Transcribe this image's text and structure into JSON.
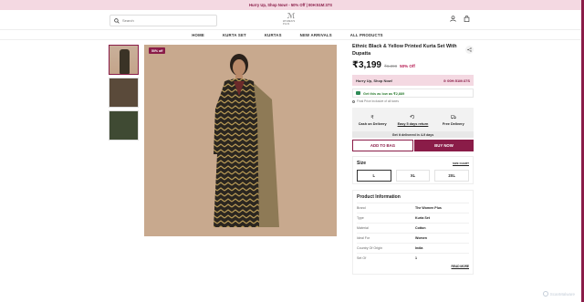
{
  "promo": {
    "text": "Hurry Up, Shop Now! - 50% Off   |   00H:51M:37S"
  },
  "header": {
    "search_placeholder": "Search",
    "logo_text": "WOMEN'S PLUS"
  },
  "nav": {
    "items": [
      "HOME",
      "KURTA SET",
      "KURTAS",
      "NEW ARRIVALS",
      "ALL PRODUCTS"
    ]
  },
  "gallery": {
    "badge": "50% off"
  },
  "product": {
    "title": "Ethnic Black & Yellow Printed Kurta Set With Dupatta",
    "price": "₹3,199",
    "mrp": "₹6,398",
    "discount": "50% Off",
    "hurry_label": "Hurry Up, Shop Now!",
    "timer": "⊙ 00H:51M:37S",
    "as_low_as": "Get this as low as ₹2,889",
    "inclusive": "Final Price Inclusive of all taxes",
    "features": [
      "Cash on Delivery",
      "Easy 5 days return",
      "Free Delivery"
    ],
    "delivery_note": "Get it delivered in 4-9 days",
    "add_to_bag": "ADD TO BAG",
    "buy_now": "BUY NOW"
  },
  "size": {
    "label": "Size",
    "chart_link": "SIZE CHART",
    "options": [
      "L",
      "XL",
      "2XL"
    ],
    "selected": "L"
  },
  "info": {
    "heading": "Product Information",
    "rows": [
      {
        "k": "Brand",
        "v": "The Women Plus"
      },
      {
        "k": "Type",
        "v": "Kurta Set"
      },
      {
        "k": "Material",
        "v": "Cotton"
      },
      {
        "k": "Ideal For",
        "v": "Women"
      },
      {
        "k": "Country Of Origin",
        "v": "India"
      },
      {
        "k": "Set Of",
        "v": "1"
      }
    ],
    "read_more": "READ MORE"
  },
  "watermark": "ScanMalware",
  "colors": {
    "brand": "#8a1c48",
    "promo_bg": "#f4d9e2",
    "green": "#2e7d32"
  }
}
